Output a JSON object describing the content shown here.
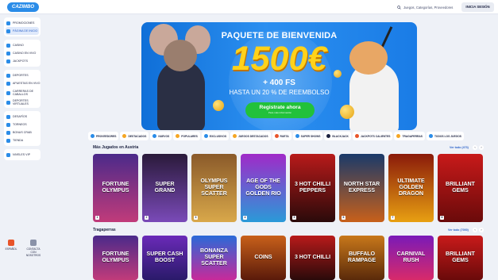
{
  "header": {
    "logo_text": "CAZIMBO",
    "search_placeholder": "Juegos, Categorías, Proveedores",
    "login_label": "INICIA SESIÓN"
  },
  "sidebar": {
    "groups": [
      [
        {
          "label": "PROMOCIONES",
          "icon": "gift-icon",
          "color": "#2a8ce8"
        },
        {
          "label": "PÁGINA DE INICIO",
          "icon": "home-icon",
          "color": "#2a8ce8",
          "active": true
        }
      ],
      [
        {
          "label": "CASINO",
          "icon": "cards-icon",
          "color": "#2a8ce8"
        },
        {
          "label": "CASINO EN VIVO",
          "icon": "live-icon",
          "color": "#2a8ce8"
        },
        {
          "label": "JACKPOTS",
          "icon": "jackpot-icon",
          "color": "#2a8ce8"
        }
      ],
      [
        {
          "label": "DEPORTES",
          "icon": "ball-icon",
          "color": "#2a8ce8"
        },
        {
          "label": "APUESTAS EN VIVO",
          "icon": "live-bet-icon",
          "color": "#2a8ce8"
        },
        {
          "label": "CARRERAS DE CABALLOS",
          "icon": "horse-icon",
          "color": "#2a8ce8"
        },
        {
          "label": "DEPORTES VIRTUALES",
          "icon": "virtual-icon",
          "color": "#2a8ce8"
        }
      ],
      [
        {
          "label": "DESAFÍOS",
          "icon": "target-icon",
          "color": "#2a8ce8"
        },
        {
          "label": "TORNEOS",
          "icon": "trophy-icon",
          "color": "#2a8ce8"
        },
        {
          "label": "BONUS CRAB",
          "icon": "crab-icon",
          "color": "#2a8ce8"
        },
        {
          "label": "TIENDA",
          "icon": "shop-icon",
          "color": "#2a8ce8"
        }
      ],
      [
        {
          "label": "NIVELES VIP",
          "icon": "vip-icon",
          "color": "#2a8ce8"
        }
      ]
    ],
    "bottom": [
      {
        "label": "ESPAÑOL",
        "icon": "flag-icon",
        "color": "#e8542a"
      },
      {
        "label": "CONTACTA CON NOSOTROS",
        "icon": "support-icon",
        "color": "#8a92a8"
      }
    ]
  },
  "banner": {
    "title": "PAQUETE DE BIENVENIDA",
    "amount": "1500€",
    "free_spins": "+ 400 FS",
    "cashback": "HASTA UN 20 % DE REEMBOLSO",
    "cta_label": "Registrate ahora",
    "cta_sub": "Para más información"
  },
  "categories": [
    {
      "label": "PROVEEDORES",
      "color": "#2a8ce8"
    },
    {
      "label": "DESTACADOS",
      "color": "#f5a623"
    },
    {
      "label": "NUEVOS",
      "color": "#2a8ce8"
    },
    {
      "label": "POPULARES",
      "color": "#f5a623"
    },
    {
      "label": "EXCLUSIVOS",
      "color": "#2a8ce8"
    },
    {
      "label": "JUEGOS DESTACADOS",
      "color": "#f5a623"
    },
    {
      "label": "RUETA",
      "color": "#e8542a"
    },
    {
      "label": "SUPER SHOWS",
      "color": "#2a8ce8"
    },
    {
      "label": "BLACKJACK",
      "color": "#1c2240"
    },
    {
      "label": "JACKPOTS CALIENTES",
      "color": "#e8542a"
    },
    {
      "label": "TRAGAPERRAS",
      "color": "#f5a623"
    },
    {
      "label": "TODOS LOS JUEGOS",
      "color": "#2a8ce8"
    }
  ],
  "section1": {
    "title": "Más Jugados en Austria",
    "link": "Ver todo (473)",
    "games": [
      {
        "name": "FORTUNE OLYMPUS",
        "num": "1",
        "bg": "linear-gradient(180deg,#4b2a8a,#c13b7a)"
      },
      {
        "name": "SUPER GRAND",
        "num": "2",
        "bg": "linear-gradient(180deg,#2a1a3a,#7a4ab8)"
      },
      {
        "name": "OLYMPUS SUPER SCATTER",
        "num": "3",
        "bg": "linear-gradient(180deg,#8a5a2a,#d9a84a)"
      },
      {
        "name": "AGE OF THE GODS GOLDEN RIO",
        "num": "4",
        "bg": "linear-gradient(180deg,#a02ac8,#2a9ad8)"
      },
      {
        "name": "3 HOT CHILLI PEPPERS",
        "num": "5",
        "bg": "linear-gradient(180deg,#b81a1a,#2a0a0a)"
      },
      {
        "name": "NORTH STAR EXPRESS",
        "num": "6",
        "bg": "linear-gradient(180deg,#1a3a6a,#c8601a)"
      },
      {
        "name": "ULTIMATE GOLDEN DRAGON",
        "num": "7",
        "bg": "linear-gradient(180deg,#8a1a0a,#e8a012)"
      },
      {
        "name": "BRILLIANT GEMS",
        "num": "8",
        "bg": "linear-gradient(180deg,#c81a1a,#6a0a0a)"
      }
    ]
  },
  "section2": {
    "title": "Tragaperras",
    "link": "Ver todo (7000)",
    "games": [
      {
        "name": "FORTUNE OLYMPUS",
        "bg": "linear-gradient(180deg,#4b2a8a,#c13b7a)"
      },
      {
        "name": "SUPER CASH BOOST",
        "bg": "linear-gradient(180deg,#6a2ab8,#2a1a6a)"
      },
      {
        "name": "BONANZA SUPER SCATTER",
        "bg": "linear-gradient(180deg,#2a6ad8,#c82a9a)"
      },
      {
        "name": "COINS",
        "bg": "linear-gradient(180deg,#c8601a,#5a1a0a)"
      },
      {
        "name": "3 HOT CHILLI",
        "bg": "linear-gradient(180deg,#b81a1a,#2a0a0a)"
      },
      {
        "name": "BUFFALO RAMPAGE",
        "bg": "linear-gradient(180deg,#c8781a,#5a2a0a)"
      },
      {
        "name": "CARNIVAL RUSH",
        "bg": "linear-gradient(180deg,#7a1ab8,#d82a6a)"
      },
      {
        "name": "BRILLIANT GEMS",
        "bg": "linear-gradient(180deg,#c81a1a,#6a0a0a)"
      }
    ]
  },
  "arrows": {
    "prev": "‹",
    "next": "›"
  }
}
